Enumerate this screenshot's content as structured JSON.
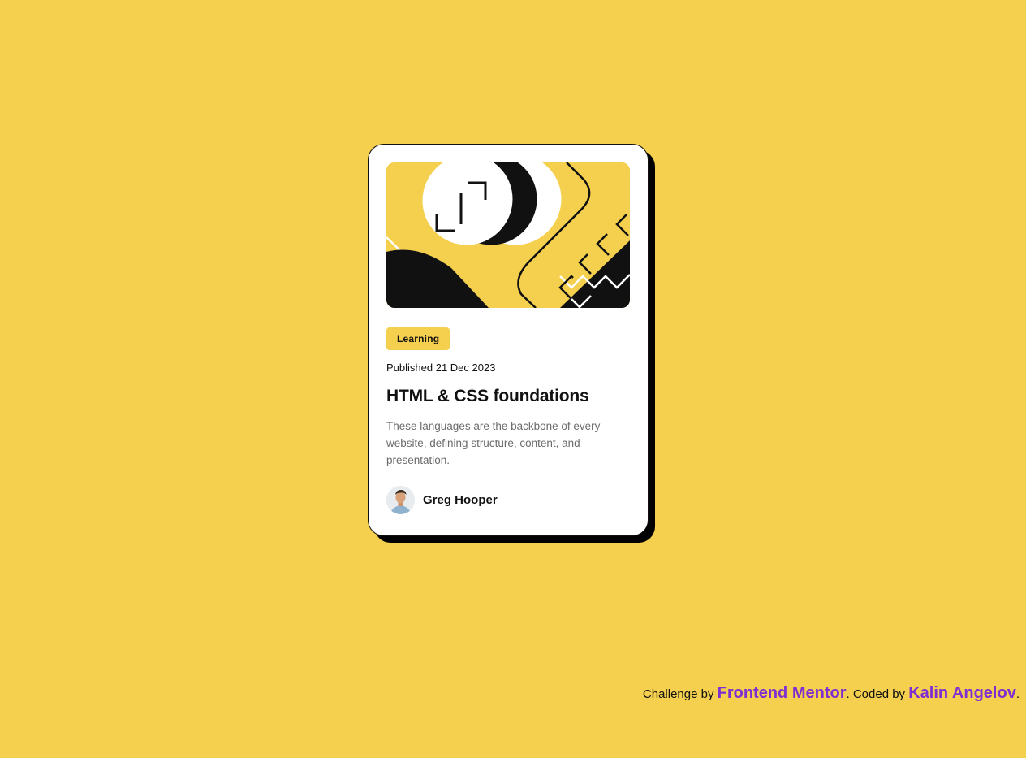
{
  "colors": {
    "background": "#F4D04E",
    "card": "#FFFFFF",
    "ink": "#111111",
    "muted": "#6B6B6B",
    "link": "#7F2ED2"
  },
  "card": {
    "illustration": "illustration-article",
    "tag": "Learning",
    "published": "Published 21 Dec 2023",
    "title": "HTML & CSS foundations",
    "description": "These languages are the backbone of every website, defining structure, content, and presentation.",
    "author": {
      "avatar": "avatar-photo",
      "name": "Greg Hooper"
    }
  },
  "attribution": {
    "prefix": "Challenge by ",
    "challenge_link": "Frontend Mentor",
    "middle": ". Coded by ",
    "coder_link": "Kalin Angelov",
    "suffix": "."
  }
}
